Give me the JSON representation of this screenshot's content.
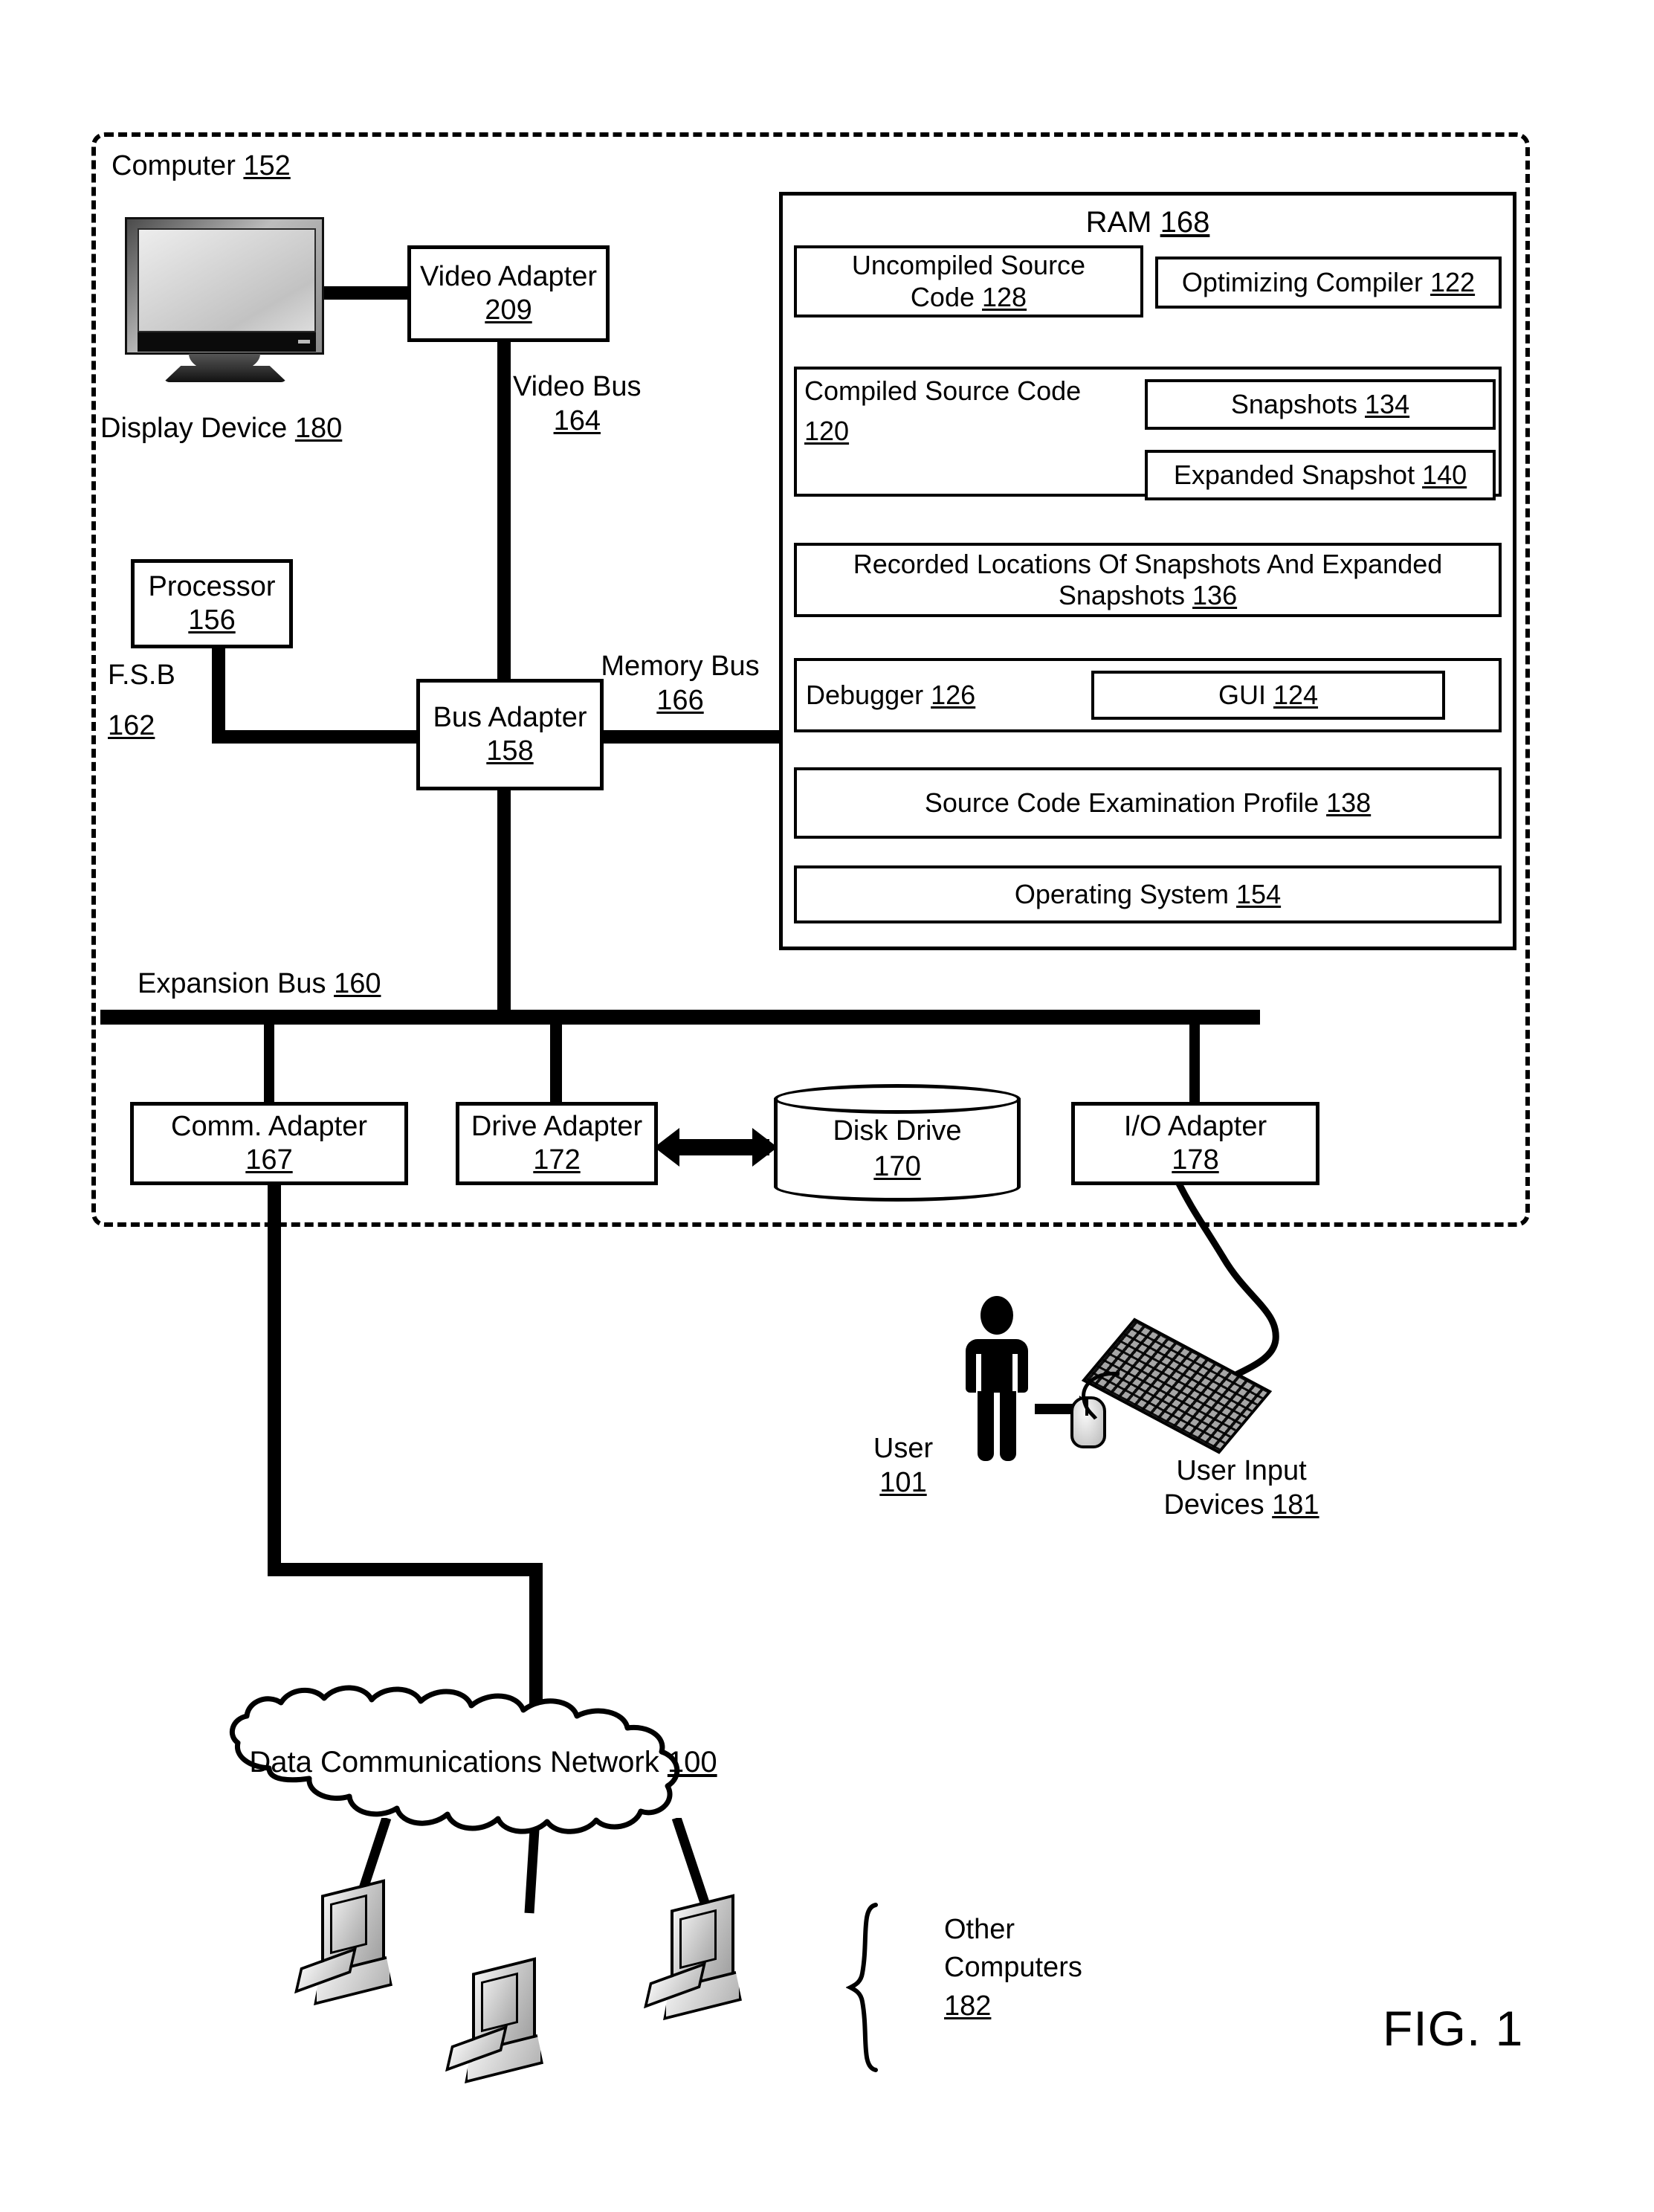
{
  "figure": {
    "caption": "FIG. 1"
  },
  "computer": {
    "label": "Computer",
    "ref": "152"
  },
  "display": {
    "label": "Display Device",
    "ref": "180"
  },
  "video_adapter": {
    "label": "Video Adapter",
    "ref": "209"
  },
  "video_bus": {
    "label": "Video Bus",
    "ref": "164"
  },
  "processor": {
    "label": "Processor",
    "ref": "156"
  },
  "fsb": {
    "label": "F.S.B",
    "ref": "162"
  },
  "bus_adapter": {
    "label": "Bus Adapter",
    "ref": "158"
  },
  "memory_bus": {
    "label": "Memory Bus",
    "ref": "166"
  },
  "expansion_bus": {
    "label": "Expansion Bus",
    "ref": "160"
  },
  "ram": {
    "label": "RAM",
    "ref": "168",
    "modules": [
      {
        "label": "Uncompiled Source Code",
        "ref": "128"
      },
      {
        "label": "Optimizing Compiler",
        "ref": "122"
      },
      {
        "label": "Compiled Source Code",
        "ref": "120"
      },
      {
        "label": "Snapshots",
        "ref": "134"
      },
      {
        "label": "Expanded Snapshot",
        "ref": "140"
      },
      {
        "label": "Recorded Locations Of Snapshots And Expanded Snapshots",
        "ref": "136"
      },
      {
        "label": "Debugger",
        "ref": "126"
      },
      {
        "label": "GUI",
        "ref": "124"
      },
      {
        "label": "Source Code Examination Profile",
        "ref": "138"
      },
      {
        "label": "Operating System",
        "ref": "154"
      }
    ],
    "uncompiled_line1": "Uncompiled Source",
    "uncompiled_line2": "Code",
    "compiled_line1": "Compiled Source Code",
    "recorded_line1": "Recorded Locations Of Snapshots And Expanded",
    "recorded_line2": "Snapshots"
  },
  "comm_adapter": {
    "label": "Comm. Adapter",
    "ref": "167"
  },
  "drive_adapter": {
    "label": "Drive Adapter",
    "ref": "172"
  },
  "disk_drive": {
    "label": "Disk Drive",
    "ref": "170"
  },
  "io_adapter": {
    "label": "I/O Adapter",
    "ref": "178"
  },
  "user": {
    "label": "User",
    "ref": "101"
  },
  "user_input": {
    "label_line1": "User Input",
    "label_line2": "Devices",
    "ref": "181"
  },
  "network": {
    "label": "Data Communications Network",
    "ref": "100"
  },
  "other_computers": {
    "label_line1": "Other",
    "label_line2": "Computers",
    "ref": "182"
  }
}
